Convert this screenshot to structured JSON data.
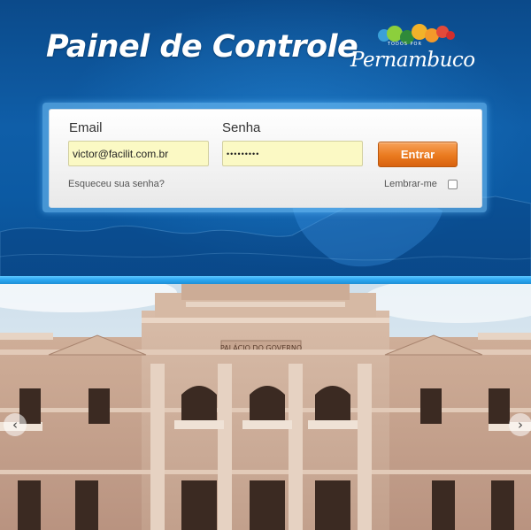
{
  "header": {
    "title": "Painel de Controle",
    "logo": {
      "small_text": "TODOS POR",
      "word": "Pernambuco"
    }
  },
  "login": {
    "email_label": "Email",
    "email_value": "victor@facilit.com.br",
    "password_label": "Senha",
    "password_value": "•••••••••",
    "submit_label": "Entrar",
    "forgot_link": "Esqueceu sua senha?",
    "remember_label": "Lembrar-me",
    "remember_checked": false
  },
  "carousel": {
    "prev_icon": "chevron-left-icon",
    "next_icon": "chevron-right-icon",
    "building_sign": "PALÁCIO DO GOVERNO"
  },
  "colors": {
    "header_blue": "#0c4f8f",
    "accent_cyan": "#2aa6f0",
    "button_orange": "#ea7a1f",
    "input_yellow": "#fbf9c4"
  }
}
